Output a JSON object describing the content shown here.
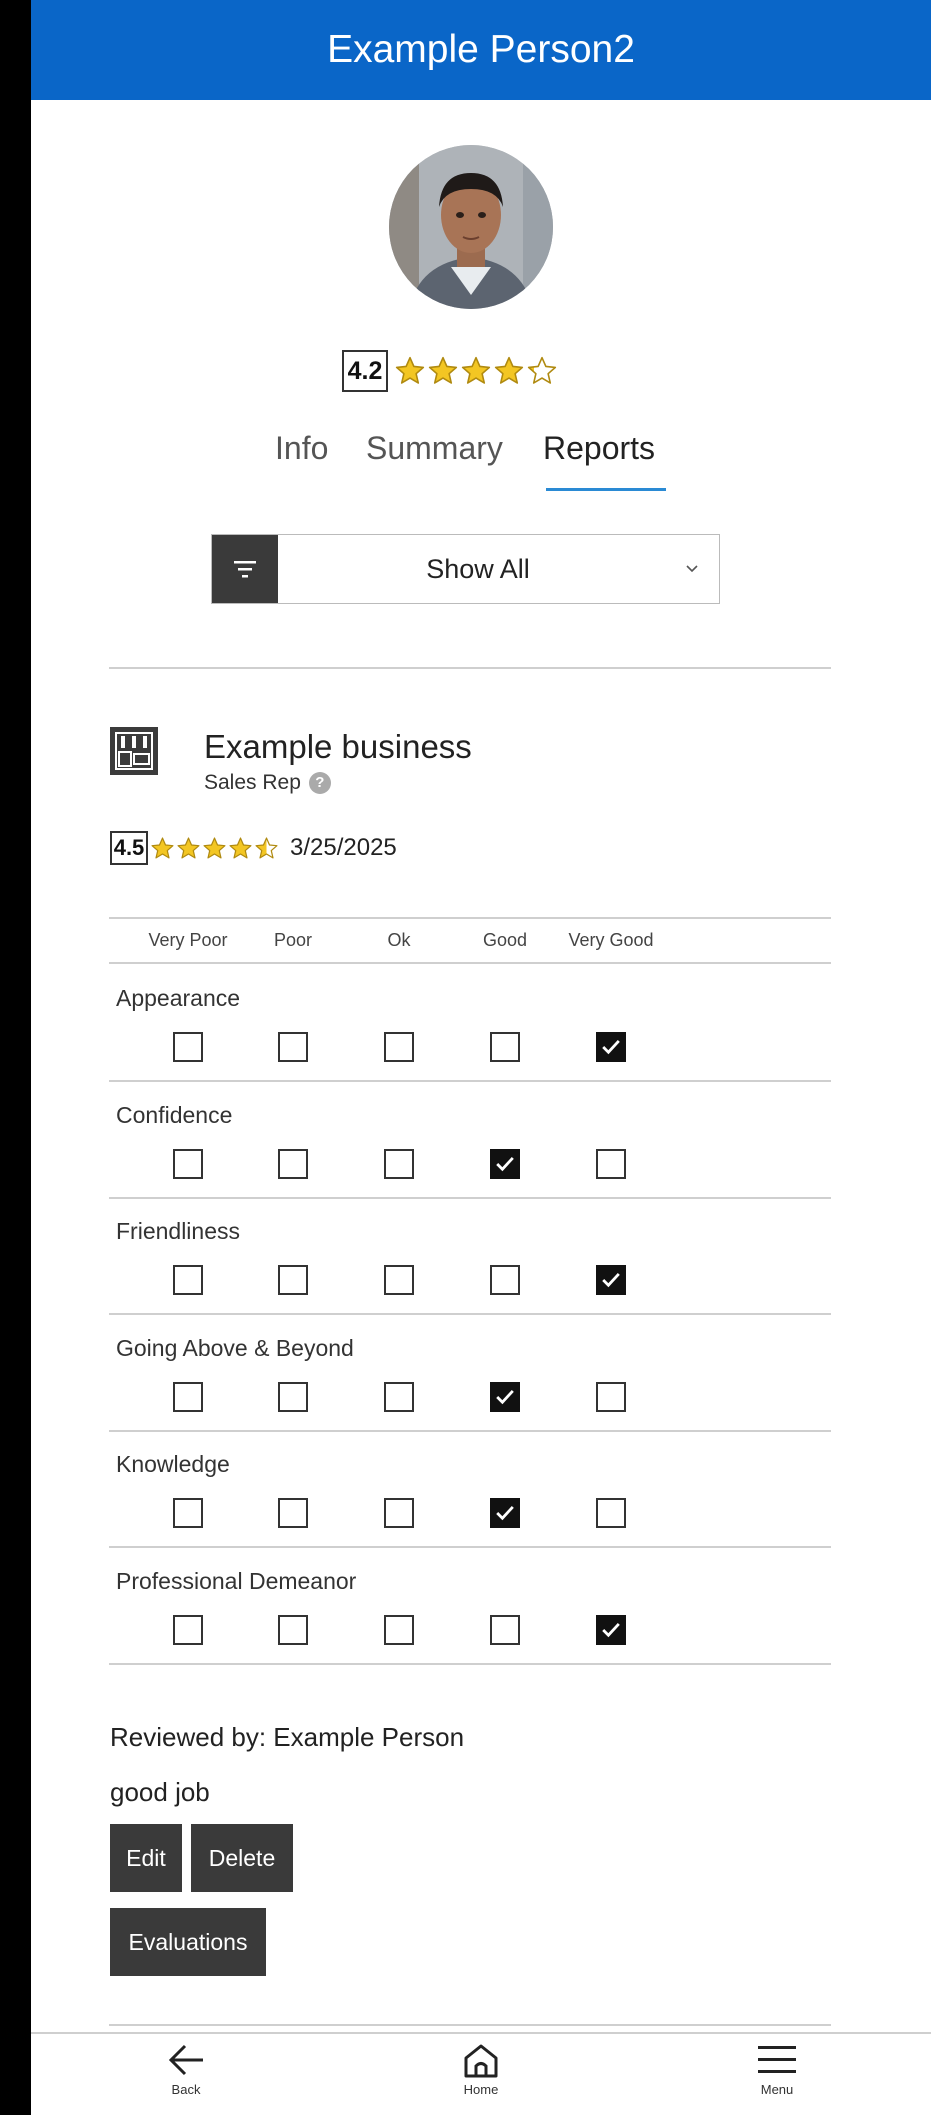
{
  "header": {
    "title": "Example Person2"
  },
  "profile": {
    "overall_rating": "4.2",
    "overall_stars": 4.2
  },
  "tabs": [
    {
      "label": "Info",
      "active": false
    },
    {
      "label": "Summary",
      "active": false
    },
    {
      "label": "Reports",
      "active": true
    }
  ],
  "filter": {
    "selected": "Show All"
  },
  "report": {
    "business_name": "Example business",
    "role": "Sales Rep",
    "rating": "4.5",
    "rating_stars": 4.5,
    "date": "3/25/2025",
    "scale": [
      "Very Poor",
      "Poor",
      "Ok",
      "Good",
      "Very Good"
    ],
    "criteria": [
      {
        "label": "Appearance",
        "selected": 4
      },
      {
        "label": "Confidence",
        "selected": 3
      },
      {
        "label": "Friendliness",
        "selected": 4
      },
      {
        "label": "Going Above & Beyond",
        "selected": 3
      },
      {
        "label": "Knowledge",
        "selected": 3
      },
      {
        "label": "Professional Demeanor",
        "selected": 4
      }
    ],
    "reviewed_by": "Reviewed by: Example Person",
    "comment": "good job",
    "edit_label": "Edit",
    "delete_label": "Delete",
    "evaluations_label": "Evaluations"
  },
  "nav": {
    "back_label": "Back",
    "home_label": "Home",
    "menu_label": "Menu"
  },
  "colors": {
    "header_bg": "#0a66c8",
    "star_fill": "#f3c623",
    "button_bg": "#3a3a3a",
    "tab_underline": "#2a8ad4"
  }
}
